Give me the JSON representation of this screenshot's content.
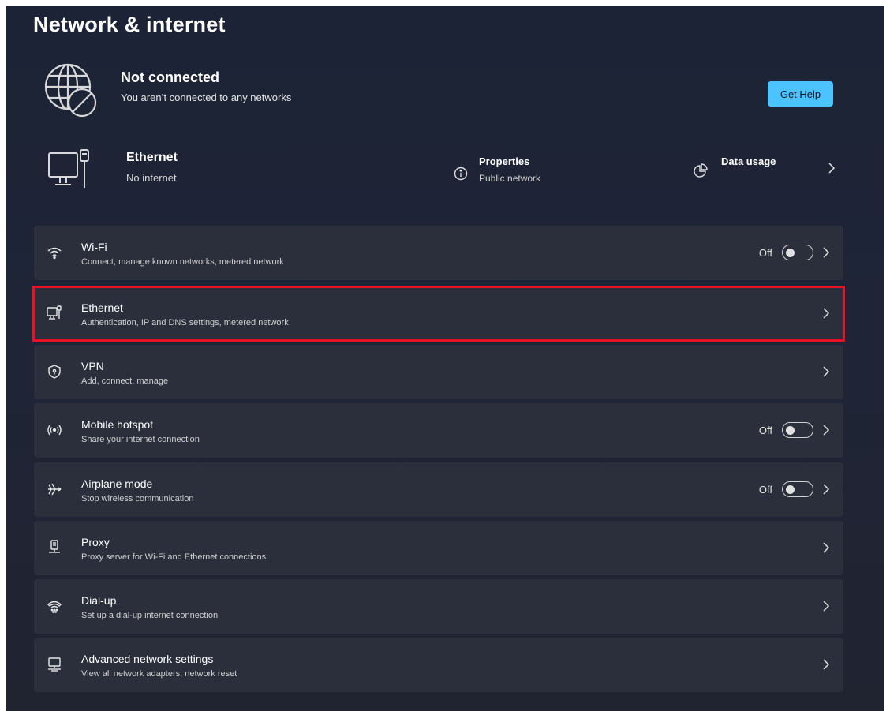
{
  "page_title": "Network & internet",
  "status": {
    "title": "Not connected",
    "subtitle": "You aren’t connected to any networks",
    "icon": "globe-blocked-icon",
    "help_button": "Get Help"
  },
  "ethernet_summary": {
    "title": "Ethernet",
    "subtitle": "No internet",
    "icon": "ethernet-pc-icon",
    "properties": {
      "title": "Properties",
      "subtitle": "Public network",
      "icon": "info-icon"
    },
    "data_usage": {
      "title": "Data usage",
      "icon": "pie-chart-icon"
    }
  },
  "settings": [
    {
      "id": "wifi",
      "icon": "wifi-icon",
      "title": "Wi-Fi",
      "subtitle": "Connect, manage known networks, metered network",
      "toggle_label": "Off",
      "toggle_on": false
    },
    {
      "id": "ethernet",
      "icon": "ethernet-icon",
      "title": "Ethernet",
      "subtitle": "Authentication, IP and DNS settings, metered network",
      "highlighted": true
    },
    {
      "id": "vpn",
      "icon": "shield-icon",
      "title": "VPN",
      "subtitle": "Add, connect, manage"
    },
    {
      "id": "mobile-hotspot",
      "icon": "hotspot-icon",
      "title": "Mobile hotspot",
      "subtitle": "Share your internet connection",
      "toggle_label": "Off",
      "toggle_on": false
    },
    {
      "id": "airplane-mode",
      "icon": "airplane-icon",
      "title": "Airplane mode",
      "subtitle": "Stop wireless communication",
      "toggle_label": "Off",
      "toggle_on": false
    },
    {
      "id": "proxy",
      "icon": "proxy-icon",
      "title": "Proxy",
      "subtitle": "Proxy server for Wi-Fi and Ethernet connections"
    },
    {
      "id": "dial-up",
      "icon": "dial-up-icon",
      "title": "Dial-up",
      "subtitle": "Set up a dial-up internet connection"
    },
    {
      "id": "advanced",
      "icon": "network-adapter-icon",
      "title": "Advanced network settings",
      "subtitle": "View all network adapters, network reset"
    }
  ],
  "colors": {
    "accent": "#4cc2ff",
    "highlight": "#e81224",
    "card": "#2b2f3c"
  }
}
